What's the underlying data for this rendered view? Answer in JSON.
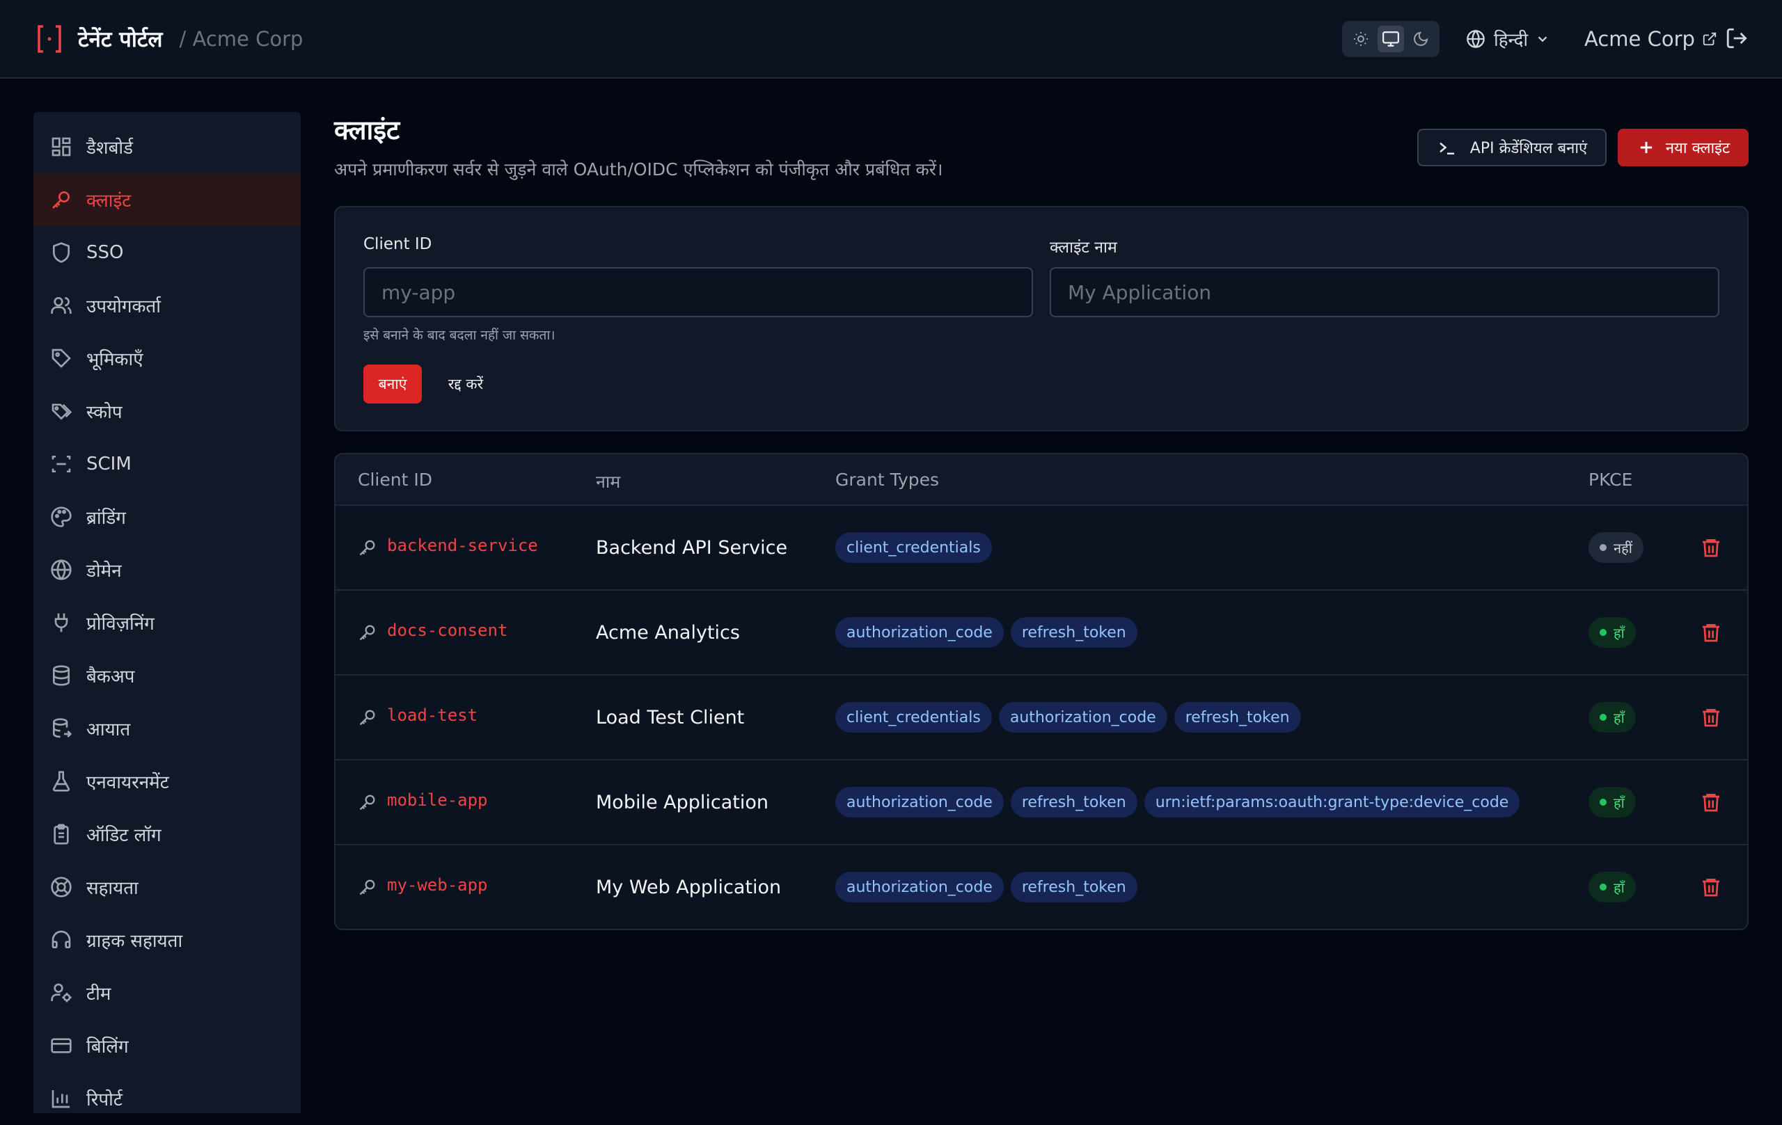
{
  "header": {
    "title": "टेनेंट पोर्टल",
    "tenant": "/ Acme Corp",
    "language": "हिन्दी",
    "tenant_link": "Acme Corp",
    "theme_options": [
      "sun-icon",
      "monitor-icon",
      "moon-icon"
    ],
    "theme_selected": "monitor-icon"
  },
  "sidebar": {
    "items": [
      {
        "label": "डैशबोर्ड",
        "icon": "dashboard-icon"
      },
      {
        "label": "क्लाइंट",
        "icon": "key-icon",
        "active": true
      },
      {
        "label": "SSO",
        "icon": "shield-icon"
      },
      {
        "label": "उपयोगकर्ता",
        "icon": "users-icon"
      },
      {
        "label": "भूमिकाएँ",
        "icon": "tag-icon"
      },
      {
        "label": "स्कोप",
        "icon": "tags-icon"
      },
      {
        "label": "SCIM",
        "icon": "scan-icon"
      },
      {
        "label": "ब्रांडिंग",
        "icon": "palette-icon"
      },
      {
        "label": "डोमेन",
        "icon": "globe-icon"
      },
      {
        "label": "प्रोविज़निंग",
        "icon": "plug-icon"
      },
      {
        "label": "बैकअप",
        "icon": "database-icon"
      },
      {
        "label": "आयात",
        "icon": "database-import-icon"
      },
      {
        "label": "एनवायरनमेंट",
        "icon": "flask-icon"
      },
      {
        "label": "ऑडिट लॉग",
        "icon": "clipboard-icon"
      },
      {
        "label": "सहायता",
        "icon": "lifebuoy-icon"
      },
      {
        "label": "ग्राहक सहायता",
        "icon": "headset-icon"
      },
      {
        "label": "टीम",
        "icon": "user-cog-icon"
      },
      {
        "label": "बिलिंग",
        "icon": "credit-card-icon"
      },
      {
        "label": "रिपोर्ट",
        "icon": "bar-chart-icon"
      }
    ]
  },
  "page": {
    "title": "क्लाइंट",
    "subtitle": "अपने प्रमाणीकरण सर्वर से जुड़ने वाले OAuth/OIDC एप्लिकेशन को पंजीकृत और प्रबंधित करें।",
    "btn_api": "API क्रेडेंशियल बनाएं",
    "btn_new": "नया क्लाइंट"
  },
  "form": {
    "client_id_label": "Client ID",
    "client_id_placeholder": "my-app",
    "client_id_value": "",
    "name_label": "क्लाइंट नाम",
    "name_placeholder": "My Application",
    "name_value": "",
    "help": "इसे बनाने के बाद बदला नहीं जा सकता।",
    "create": "बनाएं",
    "cancel": "रद्द करें"
  },
  "table": {
    "headers": {
      "client_id": "Client ID",
      "name": "नाम",
      "grants": "Grant Types",
      "pkce": "PKCE"
    },
    "rows": [
      {
        "client_id": "backend-service",
        "name": "Backend API Service",
        "grants": [
          "client_credentials"
        ],
        "pkce": "नहीं",
        "pkce_on": false
      },
      {
        "client_id": "docs-consent",
        "name": "Acme Analytics",
        "grants": [
          "authorization_code",
          "refresh_token"
        ],
        "pkce": "हाँ",
        "pkce_on": true
      },
      {
        "client_id": "load-test",
        "name": "Load Test Client",
        "grants": [
          "client_credentials",
          "authorization_code",
          "refresh_token"
        ],
        "pkce": "हाँ",
        "pkce_on": true
      },
      {
        "client_id": "mobile-app",
        "name": "Mobile Application",
        "grants": [
          "authorization_code",
          "refresh_token",
          "urn:ietf:params:oauth:grant-type:device_code"
        ],
        "pkce": "हाँ",
        "pkce_on": true
      },
      {
        "client_id": "my-web-app",
        "name": "My Web Application",
        "grants": [
          "authorization_code",
          "refresh_token"
        ],
        "pkce": "हाँ",
        "pkce_on": true
      }
    ]
  },
  "colors": {
    "accent": "#dc2626",
    "background": "#030712",
    "panel": "#111827",
    "pill": "#172554",
    "pill_text": "#93c5fd",
    "success": "#22c55e"
  }
}
